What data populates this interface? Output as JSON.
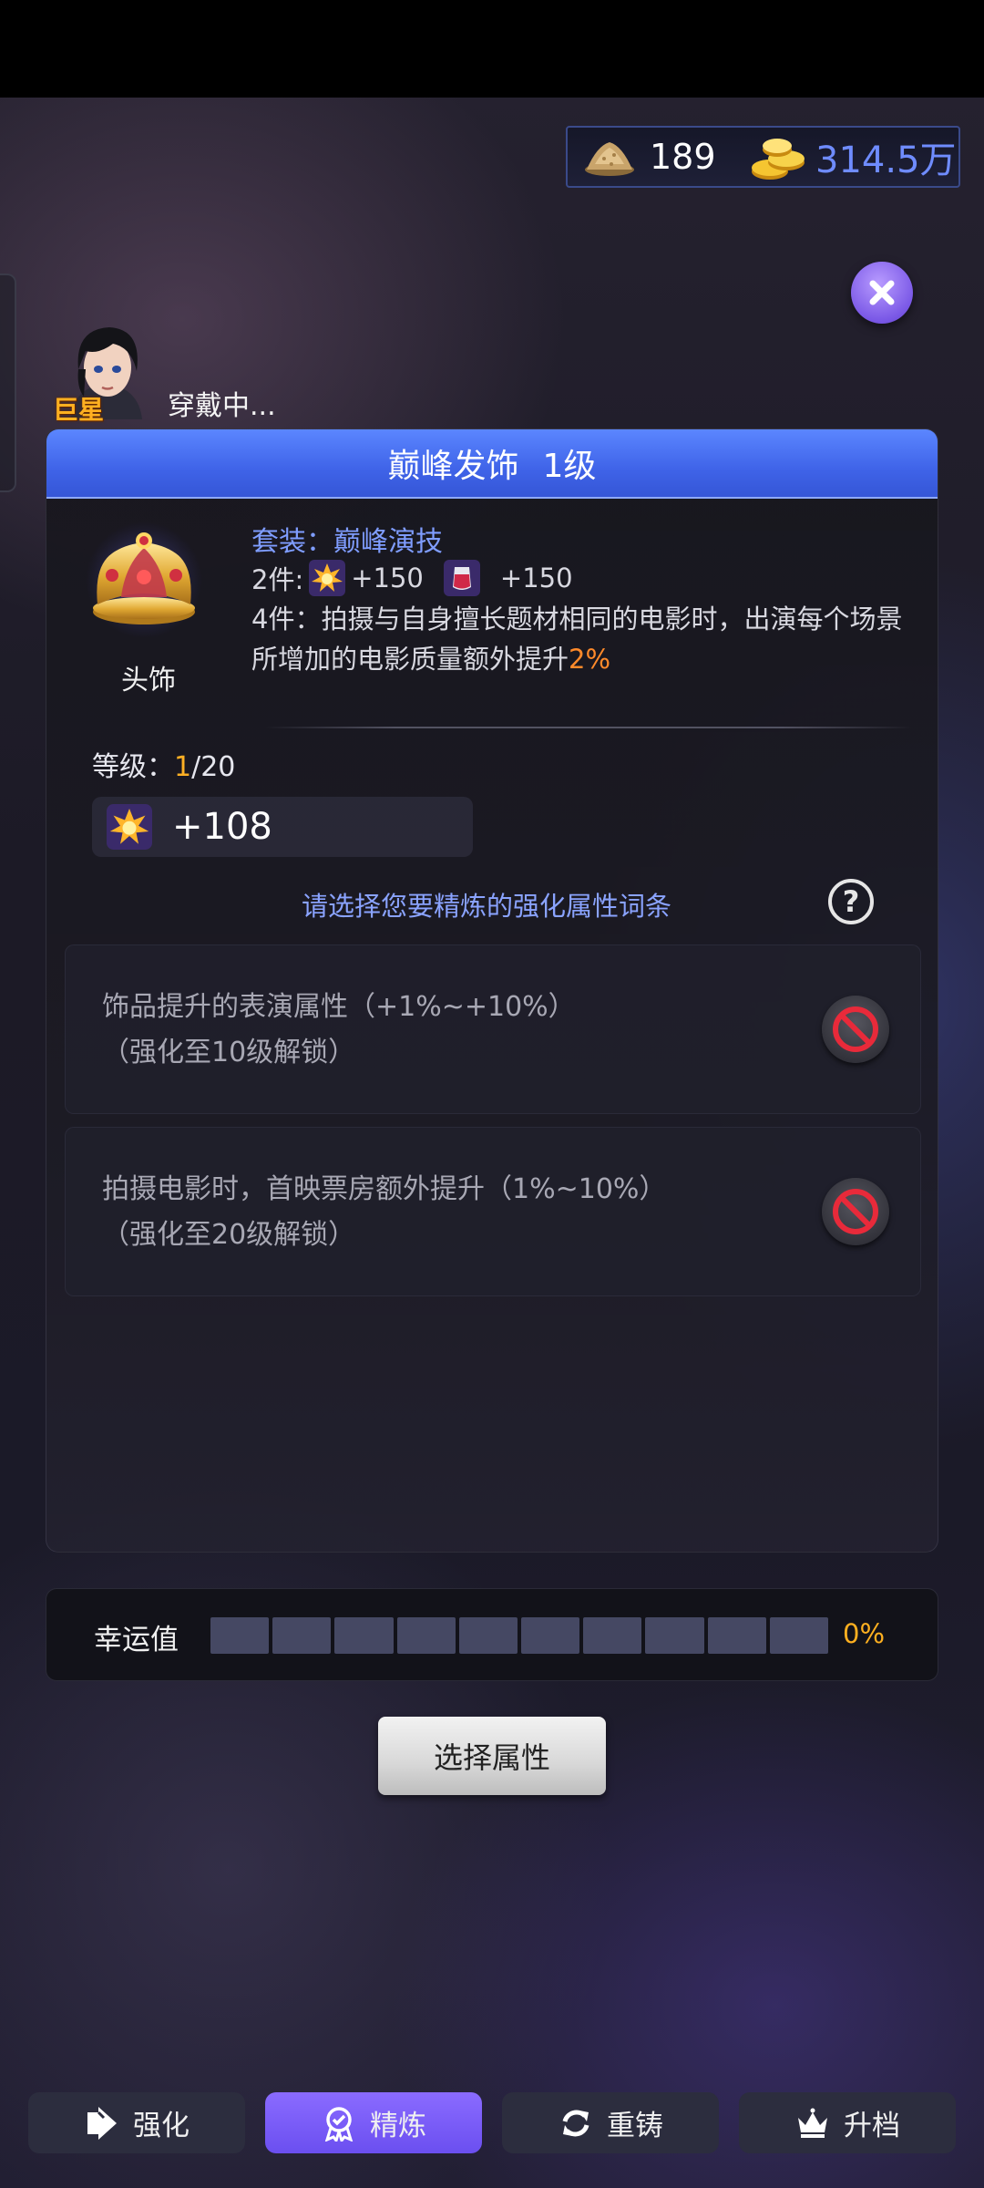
{
  "currency": {
    "material": {
      "icon": "sand-pile-icon",
      "value": "189"
    },
    "gold": {
      "icon": "gold-coins-icon",
      "value": "314.5万"
    }
  },
  "character": {
    "badge": "巨星",
    "status": "穿戴中..."
  },
  "panel": {
    "title": "巅峰发饰",
    "level": "1级",
    "item_type": "头饰",
    "set_title": "套装：巅峰演技",
    "set_2_prefix": "2件:",
    "set_2_bonus_a": "+150",
    "set_2_bonus_b": "+150",
    "set_4_text": "4件：拍摄与自身擅长题材相同的电影时，出演每个场景所增加的电影质量额外提升",
    "set_4_highlight": "2%",
    "level_label": "等级：",
    "level_current": "1",
    "level_max": "/20",
    "stat_value": "+108",
    "prompt": "请选择您要精炼的强化属性词条",
    "help": "?",
    "attributes": [
      {
        "line1": "饰品提升的表演属性（+1%~+10%）",
        "line2": "（强化至10级解锁）"
      },
      {
        "line1": "拍摄电影时，首映票房额外提升（1%~10%）",
        "line2": "（强化至20级解锁）"
      }
    ]
  },
  "luck": {
    "label": "幸运值",
    "segments": 10,
    "progress": 0,
    "percent_text": "0%"
  },
  "select_button": "选择属性",
  "tabs": [
    {
      "label": "强化",
      "icon": "arrow-right-icon",
      "active": false
    },
    {
      "label": "精炼",
      "icon": "medal-icon",
      "active": true
    },
    {
      "label": "重铸",
      "icon": "refresh-icon",
      "active": false
    },
    {
      "label": "升档",
      "icon": "crown-icon",
      "active": false
    }
  ],
  "colors": {
    "accent": "#7a58e6",
    "header_blue": "#4a6ff0",
    "highlight_orange": "#ff8a2a",
    "link_blue": "#8aa3ff"
  }
}
